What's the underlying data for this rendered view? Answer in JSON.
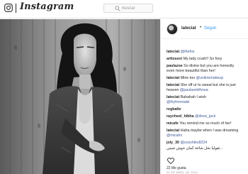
{
  "app": {
    "name": "Instagram"
  },
  "search": {
    "placeholder": "Buscar"
  },
  "post": {
    "username": "lateciat",
    "follow_label": "Seguir",
    "dot": "•",
    "likes": "22 Me gusta",
    "date": "22 DE ABRIL DE 2014",
    "image": "black-and-white portrait photo"
  },
  "comments": [
    {
      "user": "lateciat",
      "mention": "@thefox",
      "text": ""
    },
    {
      "user": "arttosexi",
      "mention": "",
      "text": "My lady crush!! So foxy"
    },
    {
      "user": "paulazoe",
      "mention": "",
      "text": "So divine but you are honestly"
    },
    {
      "user": "",
      "mention": "",
      "text": "even more beautiful than her!"
    },
    {
      "user": "lateciat",
      "mention": "@unikremakeup",
      "text": "Mine too "
    },
    {
      "user": "lateciat",
      "mention": "",
      "text": "She off ur to sweat but she is just"
    },
    {
      "user": "",
      "mention": "@paulasmithnua",
      "text": "heaven "
    },
    {
      "user": "lateciat",
      "mention": "",
      "text": "Bahahah I wish"
    },
    {
      "user": "",
      "mention": "@lhyfromrakii",
      "text": ""
    },
    {
      "user": "regbalte",
      "mention": "",
      "text": ""
    },
    {
      "user": "raycheel_hibha",
      "mention": "@drew_jack",
      "text": ""
    },
    {
      "user": "micafe",
      "mention": "",
      "text": "You remind me so much of her!"
    },
    {
      "user": "lateciat",
      "mention": "",
      "text": "Haha maybe when I was dreaming"
    },
    {
      "user": "",
      "mention": "@micahx",
      "text": ""
    },
    {
      "user": "joly_30",
      "mention": "@coochikx8224",
      "text": ""
    },
    {
      "user": "",
      "mention": "",
      "text": "ثقوليا بحل شاغة كمان جوش شيتي..."
    }
  ]
}
